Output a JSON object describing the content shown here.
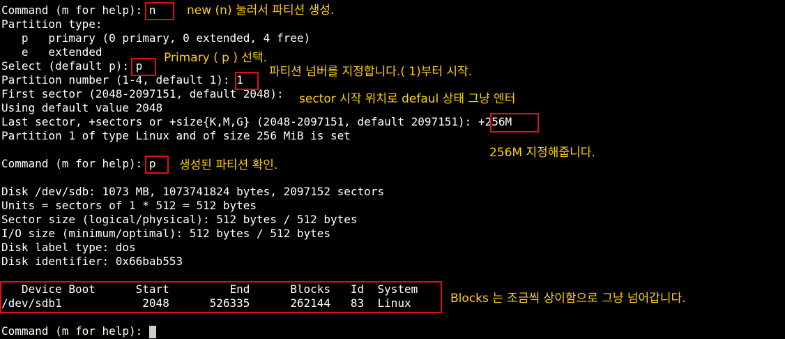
{
  "terminal": {
    "lines": [
      "Command (m for help): n",
      "Partition type:",
      "   p   primary (0 primary, 0 extended, 4 free)",
      "   e   extended",
      "Select (default p): p",
      "Partition number (1-4, default 1): 1",
      "First sector (2048-2097151, default 2048):",
      "Using default value 2048",
      "Last sector, +sectors or +size{K,M,G} (2048-2097151, default 2097151): +256M",
      "Partition 1 of type Linux and of size 256 MiB is set",
      "",
      "Command (m for help): p",
      "",
      "Disk /dev/sdb: 1073 MB, 1073741824 bytes, 2097152 sectors",
      "Units = sectors of 1 * 512 = 512 bytes",
      "Sector size (logical/physical): 512 bytes / 512 bytes",
      "I/O size (minimum/optimal): 512 bytes / 512 bytes",
      "Disk label type: dos",
      "Disk identifier: 0x66bab553",
      "",
      "   Device Boot      Start         End      Blocks   Id  System",
      "/dev/sdb1            2048      526335      262144   83  Linux",
      "",
      "Command (m for help): "
    ]
  },
  "annotations": {
    "new_partition": "new (n) 눌러서 파티션 생성.",
    "primary_select": "Primary ( p ) 선택.",
    "partition_number": "파티션 넘버를 지정합니다.( 1)부터 시작.",
    "sector_start": "sector 시작 위치로 defaul 상태 그냥 엔터",
    "size_256": "256M 지정해줍니다.",
    "confirm": "생성된 파티션 확인.",
    "blocks_note": "Blocks 는 조금씩 상이함으로 그냥 넘어갑니다."
  },
  "colors": {
    "background": "#000000",
    "text": "#ffffff",
    "annotation": "#ffd000",
    "highlight_box": "#e01010"
  }
}
